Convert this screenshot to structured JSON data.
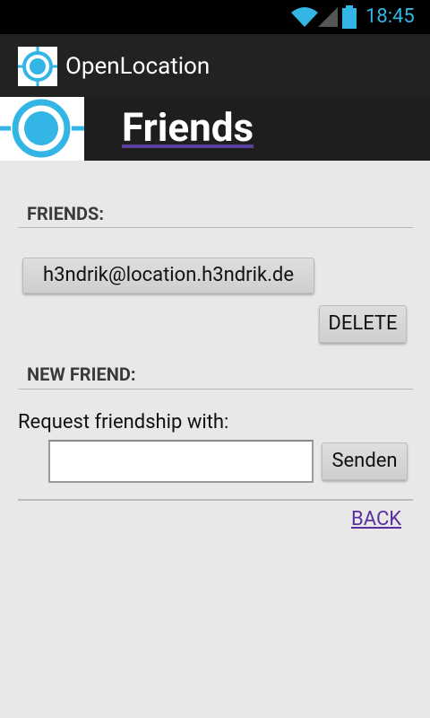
{
  "status_bar": {
    "time": "18:45",
    "accent_color": "#33b5e5"
  },
  "app": {
    "title": "OpenLocation",
    "icon": "crosshair-target-icon"
  },
  "page": {
    "title": "Friends"
  },
  "friends_section": {
    "header": "FRIENDS:",
    "items": [
      "h3ndrik@location.h3ndrik.de"
    ],
    "delete_label": "DELETE"
  },
  "new_friend_section": {
    "header": "NEW FRIEND:",
    "request_label": "Request friendship with:",
    "input_value": "",
    "input_placeholder": "",
    "send_label": "Senden"
  },
  "back_label": "BACK"
}
